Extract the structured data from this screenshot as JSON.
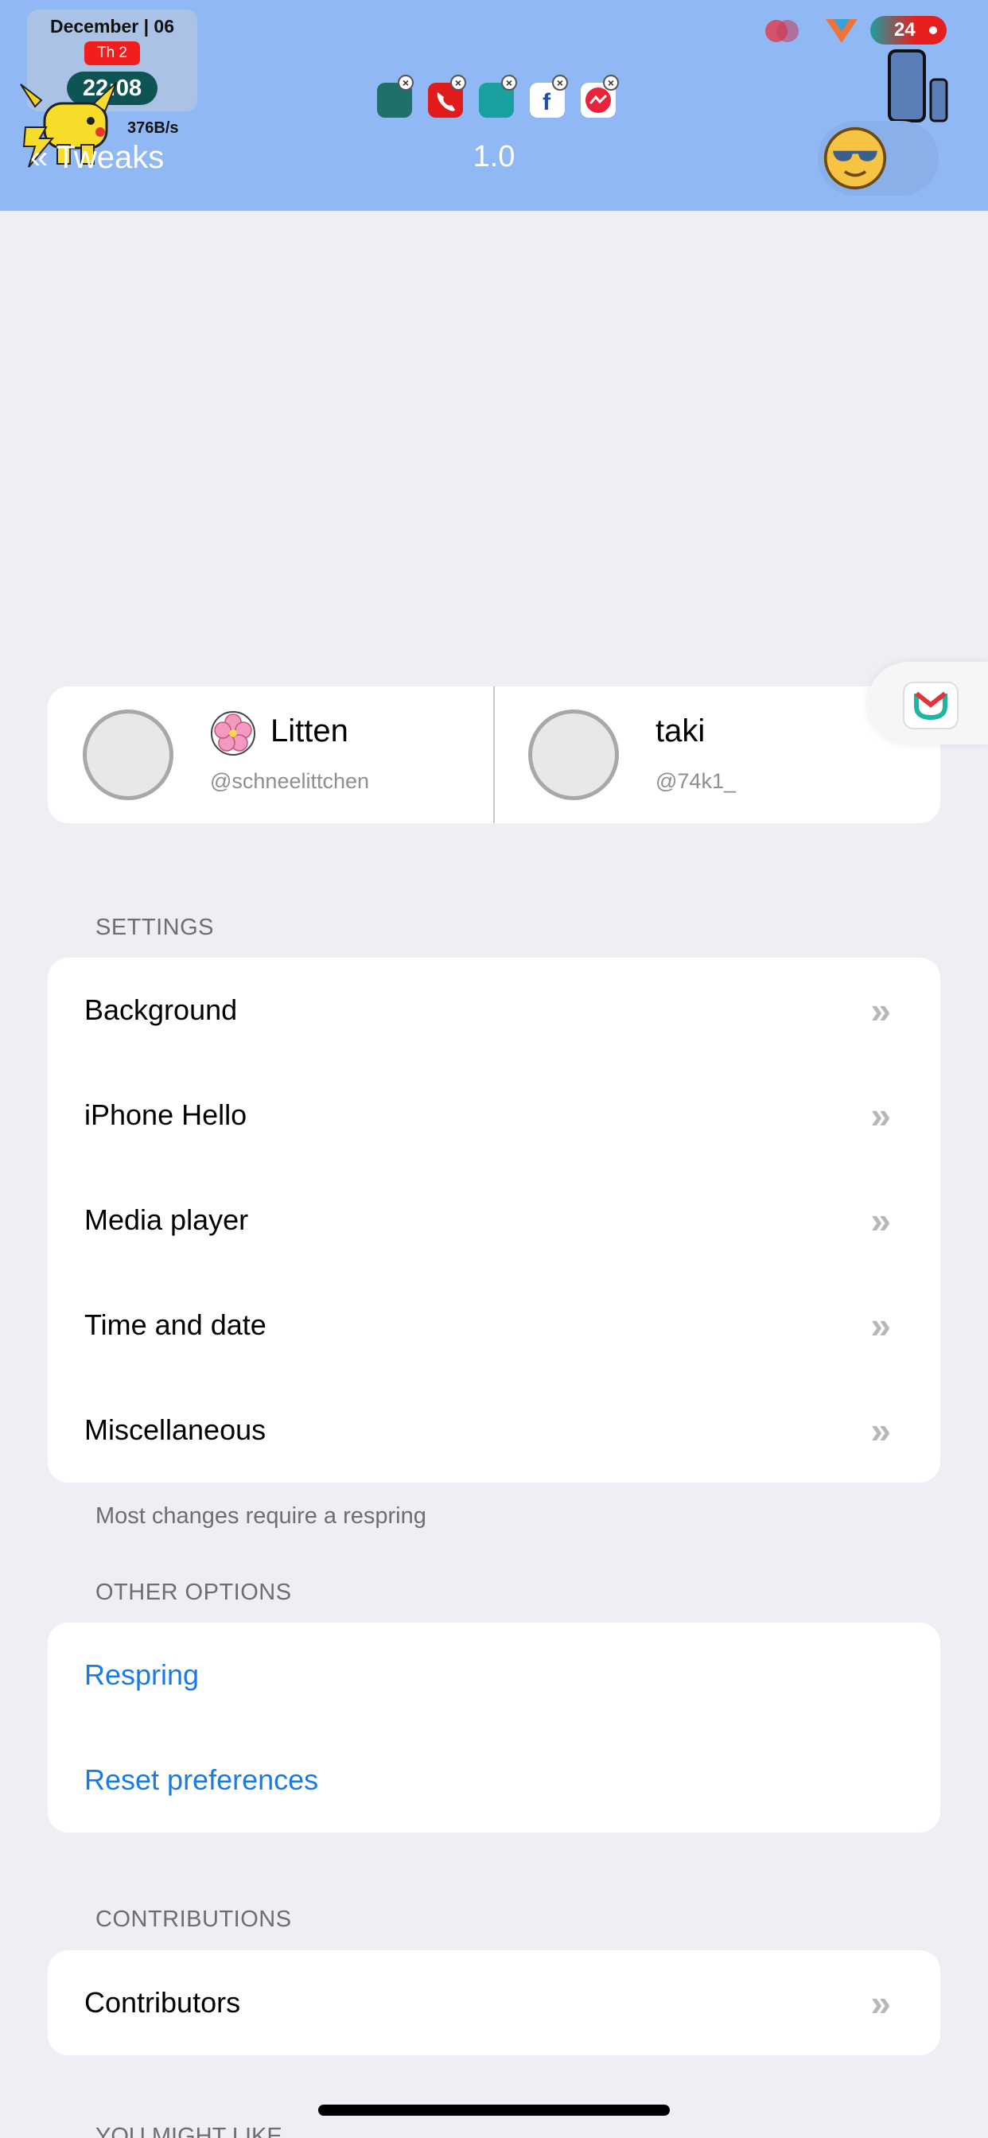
{
  "header": {
    "date_widget": {
      "date": "December | 06",
      "day": "Th 2",
      "time": "22:08",
      "net_speed": "376B/s"
    },
    "battery_level": "24",
    "back_label": "«",
    "back_title": "Tweaks",
    "title": "1.0",
    "colors": {
      "bar": "#8fb8f5"
    }
  },
  "authors": [
    {
      "name": "Litten",
      "handle": "@schneelittchen",
      "icon": "flower-icon"
    },
    {
      "name": "taki",
      "handle": "@74k1_"
    }
  ],
  "settings": {
    "header": "SETTINGS",
    "items": [
      {
        "label": "Background"
      },
      {
        "label": "iPhone Hello"
      },
      {
        "label": "Media player"
      },
      {
        "label": "Time and date"
      },
      {
        "label": "Miscellaneous"
      }
    ],
    "footer": "Most changes require a respring"
  },
  "other_options": {
    "header": "OTHER OPTIONS",
    "items": [
      {
        "label": "Respring",
        "color": "#1a7be6"
      },
      {
        "label": "Reset preferences",
        "color": "#1a7be6"
      }
    ]
  },
  "contributions": {
    "header": "CONTRIBUTIONS",
    "items": [
      {
        "label": "Contributors"
      }
    ]
  },
  "next_section_header": "YOU MIGHT LIKE"
}
